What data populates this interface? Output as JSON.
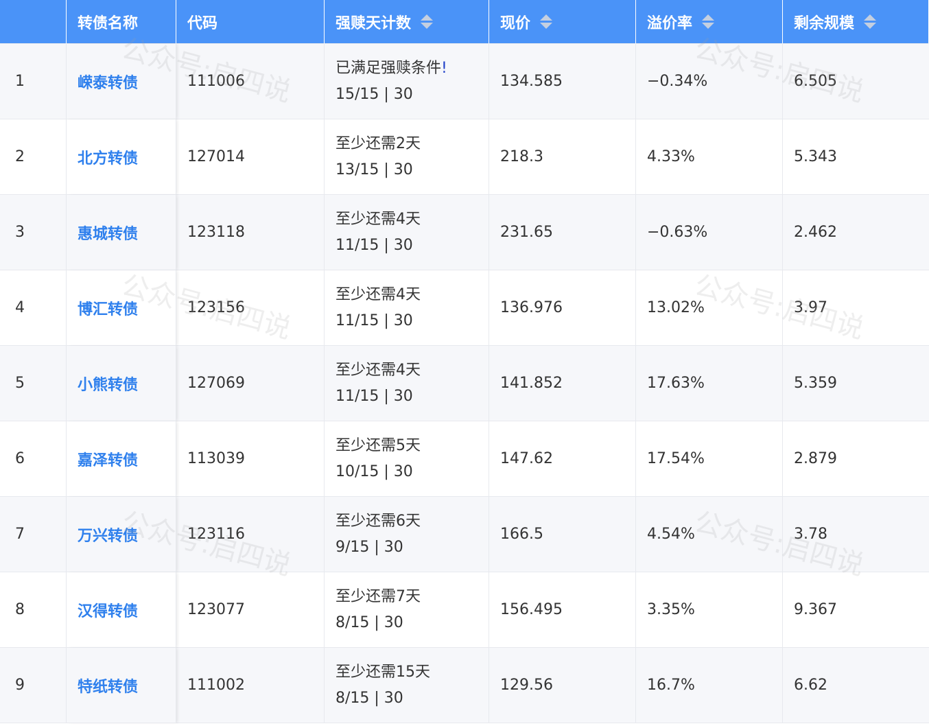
{
  "header": {
    "index": "",
    "name": "转债名称",
    "code": "代码",
    "redeem_days": "强赎天计数",
    "price": "现价",
    "premium": "溢价率",
    "scale": "剩余规模"
  },
  "watermark": "公众号:启四说",
  "rows": [
    {
      "idx": "1",
      "name": "嵘泰转债",
      "code": "111006",
      "status": "已满足强赎条件",
      "mark": "!",
      "count": "15/15 | 30",
      "price": "134.585",
      "premium": "−0.34%",
      "scale": "6.505"
    },
    {
      "idx": "2",
      "name": "北方转债",
      "code": "127014",
      "status": "至少还需2天",
      "mark": "",
      "count": "13/15 | 30",
      "price": "218.3",
      "premium": "4.33%",
      "scale": "5.343"
    },
    {
      "idx": "3",
      "name": "惠城转债",
      "code": "123118",
      "status": "至少还需4天",
      "mark": "",
      "count": "11/15 | 30",
      "price": "231.65",
      "premium": "−0.63%",
      "scale": "2.462"
    },
    {
      "idx": "4",
      "name": "博汇转债",
      "code": "123156",
      "status": "至少还需4天",
      "mark": "",
      "count": "11/15 | 30",
      "price": "136.976",
      "premium": "13.02%",
      "scale": "3.97"
    },
    {
      "idx": "5",
      "name": "小熊转债",
      "code": "127069",
      "status": "至少还需4天",
      "mark": "",
      "count": "11/15 | 30",
      "price": "141.852",
      "premium": "17.63%",
      "scale": "5.359"
    },
    {
      "idx": "6",
      "name": "嘉泽转债",
      "code": "113039",
      "status": "至少还需5天",
      "mark": "",
      "count": "10/15 | 30",
      "price": "147.62",
      "premium": "17.54%",
      "scale": "2.879"
    },
    {
      "idx": "7",
      "name": "万兴转债",
      "code": "123116",
      "status": "至少还需6天",
      "mark": "",
      "count": "9/15 | 30",
      "price": "166.5",
      "premium": "4.54%",
      "scale": "3.78"
    },
    {
      "idx": "8",
      "name": "汉得转债",
      "code": "123077",
      "status": "至少还需7天",
      "mark": "",
      "count": "8/15 | 30",
      "price": "156.495",
      "premium": "3.35%",
      "scale": "9.367"
    },
    {
      "idx": "9",
      "name": "特纸转债",
      "code": "111002",
      "status": "至少还需15天",
      "mark": "",
      "count": "8/15 | 30",
      "price": "129.56",
      "premium": "16.7%",
      "scale": "6.62"
    }
  ]
}
